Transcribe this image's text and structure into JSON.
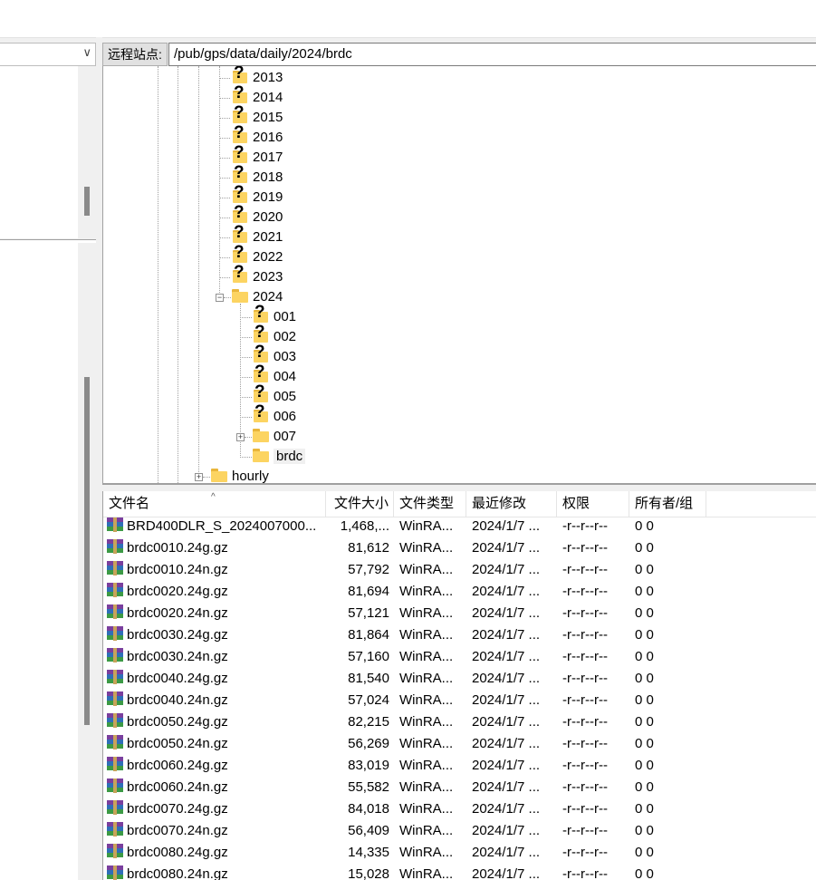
{
  "remote": {
    "label": "远程站点:",
    "path": "/pub/gps/data/daily/2024/brdc"
  },
  "tree": {
    "years": [
      {
        "label": "2013"
      },
      {
        "label": "2014"
      },
      {
        "label": "2015"
      },
      {
        "label": "2016"
      },
      {
        "label": "2017"
      },
      {
        "label": "2018"
      },
      {
        "label": "2019"
      },
      {
        "label": "2020"
      },
      {
        "label": "2021"
      },
      {
        "label": "2022"
      },
      {
        "label": "2023"
      }
    ],
    "current_year": "2024",
    "days": [
      {
        "label": "001"
      },
      {
        "label": "002"
      },
      {
        "label": "003"
      },
      {
        "label": "004"
      },
      {
        "label": "005"
      },
      {
        "label": "006"
      }
    ],
    "day_007": "007",
    "brdc": "brdc",
    "hourly": "hourly"
  },
  "list": {
    "columns": [
      "文件名",
      "文件大小",
      "文件类型",
      "最近修改",
      "权限",
      "所有者/组"
    ],
    "sort_indicator": "^",
    "rows": [
      {
        "name": "BRD400DLR_S_2024007000...",
        "size": "1,468,...",
        "type": "WinRA...",
        "modified": "2024/1/7 ...",
        "perm": "-r--r--r--",
        "owner": "0 0"
      },
      {
        "name": "brdc0010.24g.gz",
        "size": "81,612",
        "type": "WinRA...",
        "modified": "2024/1/7 ...",
        "perm": "-r--r--r--",
        "owner": "0 0"
      },
      {
        "name": "brdc0010.24n.gz",
        "size": "57,792",
        "type": "WinRA...",
        "modified": "2024/1/7 ...",
        "perm": "-r--r--r--",
        "owner": "0 0"
      },
      {
        "name": "brdc0020.24g.gz",
        "size": "81,694",
        "type": "WinRA...",
        "modified": "2024/1/7 ...",
        "perm": "-r--r--r--",
        "owner": "0 0"
      },
      {
        "name": "brdc0020.24n.gz",
        "size": "57,121",
        "type": "WinRA...",
        "modified": "2024/1/7 ...",
        "perm": "-r--r--r--",
        "owner": "0 0"
      },
      {
        "name": "brdc0030.24g.gz",
        "size": "81,864",
        "type": "WinRA...",
        "modified": "2024/1/7 ...",
        "perm": "-r--r--r--",
        "owner": "0 0"
      },
      {
        "name": "brdc0030.24n.gz",
        "size": "57,160",
        "type": "WinRA...",
        "modified": "2024/1/7 ...",
        "perm": "-r--r--r--",
        "owner": "0 0"
      },
      {
        "name": "brdc0040.24g.gz",
        "size": "81,540",
        "type": "WinRA...",
        "modified": "2024/1/7 ...",
        "perm": "-r--r--r--",
        "owner": "0 0"
      },
      {
        "name": "brdc0040.24n.gz",
        "size": "57,024",
        "type": "WinRA...",
        "modified": "2024/1/7 ...",
        "perm": "-r--r--r--",
        "owner": "0 0"
      },
      {
        "name": "brdc0050.24g.gz",
        "size": "82,215",
        "type": "WinRA...",
        "modified": "2024/1/7 ...",
        "perm": "-r--r--r--",
        "owner": "0 0"
      },
      {
        "name": "brdc0050.24n.gz",
        "size": "56,269",
        "type": "WinRA...",
        "modified": "2024/1/7 ...",
        "perm": "-r--r--r--",
        "owner": "0 0"
      },
      {
        "name": "brdc0060.24g.gz",
        "size": "83,019",
        "type": "WinRA...",
        "modified": "2024/1/7 ...",
        "perm": "-r--r--r--",
        "owner": "0 0"
      },
      {
        "name": "brdc0060.24n.gz",
        "size": "55,582",
        "type": "WinRA...",
        "modified": "2024/1/7 ...",
        "perm": "-r--r--r--",
        "owner": "0 0"
      },
      {
        "name": "brdc0070.24g.gz",
        "size": "84,018",
        "type": "WinRA...",
        "modified": "2024/1/7 ...",
        "perm": "-r--r--r--",
        "owner": "0 0"
      },
      {
        "name": "brdc0070.24n.gz",
        "size": "56,409",
        "type": "WinRA...",
        "modified": "2024/1/7 ...",
        "perm": "-r--r--r--",
        "owner": "0 0"
      },
      {
        "name": "brdc0080.24g.gz",
        "size": "14,335",
        "type": "WinRA...",
        "modified": "2024/1/7 ...",
        "perm": "-r--r--r--",
        "owner": "0 0"
      },
      {
        "name": "brdc0080.24n.gz",
        "size": "15,028",
        "type": "WinRA...",
        "modified": "2024/1/7 ...",
        "perm": "-r--r--r--",
        "owner": "0 0"
      }
    ]
  }
}
